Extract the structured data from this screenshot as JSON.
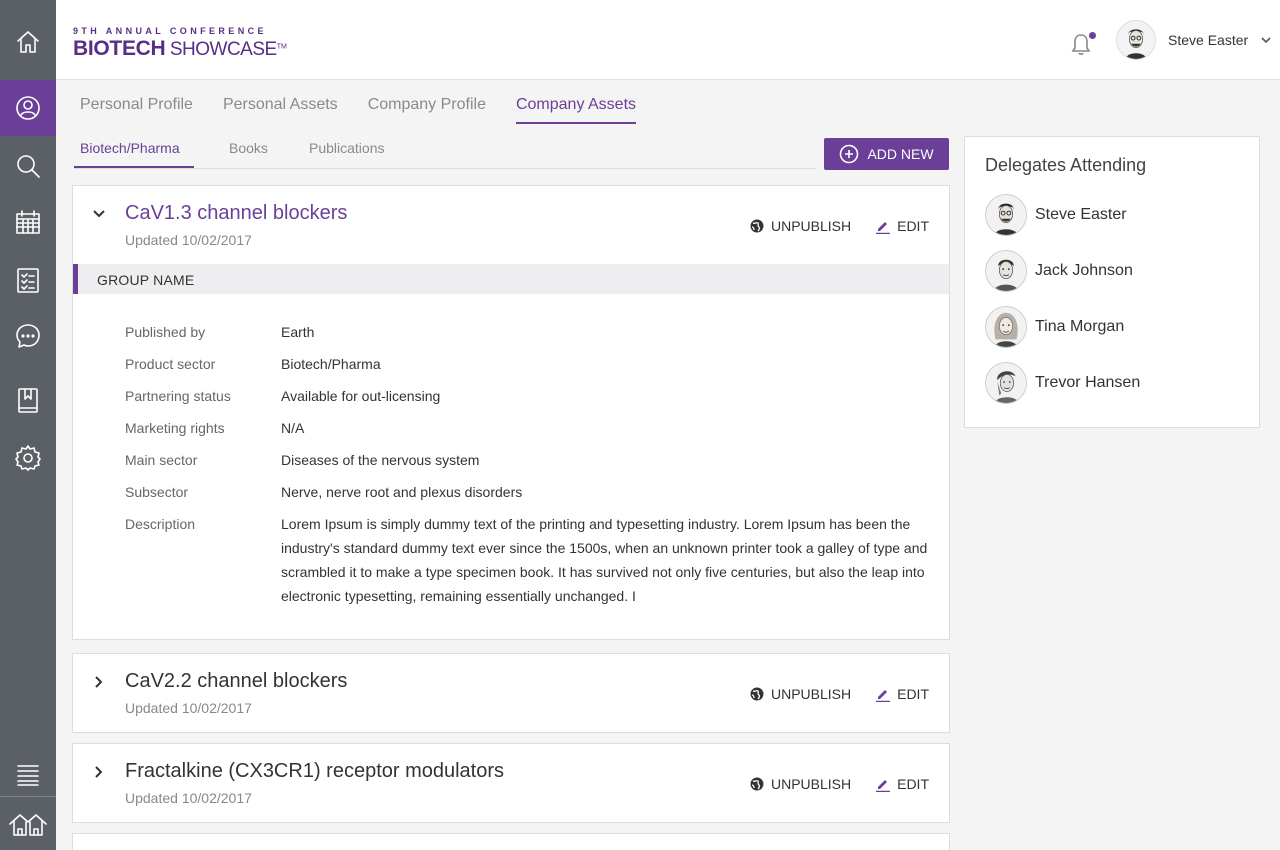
{
  "header": {
    "logo_top": "9TH ANNUAL CONFERENCE",
    "logo_bold": "BIOTECH",
    "logo_light": "SHOWCASE",
    "logo_tm": "TM",
    "user_name": "Steve Easter"
  },
  "sidebar": {
    "items": [
      {
        "icon": "home-icon"
      },
      {
        "icon": "profile-icon",
        "active": true
      },
      {
        "icon": "search-icon"
      },
      {
        "icon": "calendar-icon"
      },
      {
        "icon": "checklist-icon"
      },
      {
        "icon": "chat-icon"
      },
      {
        "icon": "bookmark-icon"
      },
      {
        "icon": "gear-icon"
      },
      {
        "icon": "list-icon"
      },
      {
        "icon": "houses-icon"
      }
    ]
  },
  "tabs": [
    "Personal Profile",
    "Personal Assets",
    "Company Profile",
    "Company Assets"
  ],
  "active_tab": "Company Assets",
  "subtabs": [
    "Biotech/Pharma",
    "Books",
    "Publications"
  ],
  "add_new_label": "ADD NEW",
  "actions": {
    "unpublish": "UNPUBLISH",
    "edit": "EDIT"
  },
  "assets": [
    {
      "title": "CaV1.3 channel blockers",
      "updated": "Updated 10/02/2017",
      "expanded": true,
      "group_name": "GROUP NAME",
      "details": [
        {
          "label": "Published by",
          "value": "Earth"
        },
        {
          "label": "Product sector",
          "value": "Biotech/Pharma"
        },
        {
          "label": "Partnering status",
          "value": "Available for out-licensing"
        },
        {
          "label": "Marketing rights",
          "value": "N/A"
        },
        {
          "label": "Main sector",
          "value": "Diseases of the nervous system"
        },
        {
          "label": "Subsector",
          "value": "Nerve, nerve root and plexus disorders"
        },
        {
          "label": "Description",
          "value": "Lorem Ipsum is simply dummy text of the printing and typesetting industry. Lorem Ipsum has been the industry's standard dummy text ever since the 1500s, when an unknown printer took a galley of type and scrambled it to make a type specimen book. It has survived not only five centuries, but also the leap into electronic typesetting, remaining essentially unchanged. I"
        }
      ]
    },
    {
      "title": "CaV2.2 channel blockers",
      "updated": "Updated 10/02/2017",
      "expanded": false
    },
    {
      "title": "Fractalkine (CX3CR1) receptor modulators",
      "updated": "Updated 10/02/2017",
      "expanded": false
    }
  ],
  "delegates": {
    "title": "Delegates Attending",
    "people": [
      "Steve Easter",
      "Jack Johnson",
      "Tina Morgan",
      "Trevor Hansen"
    ]
  },
  "colors": {
    "accent": "#6b3f98",
    "sidebar": "#5a6066"
  }
}
